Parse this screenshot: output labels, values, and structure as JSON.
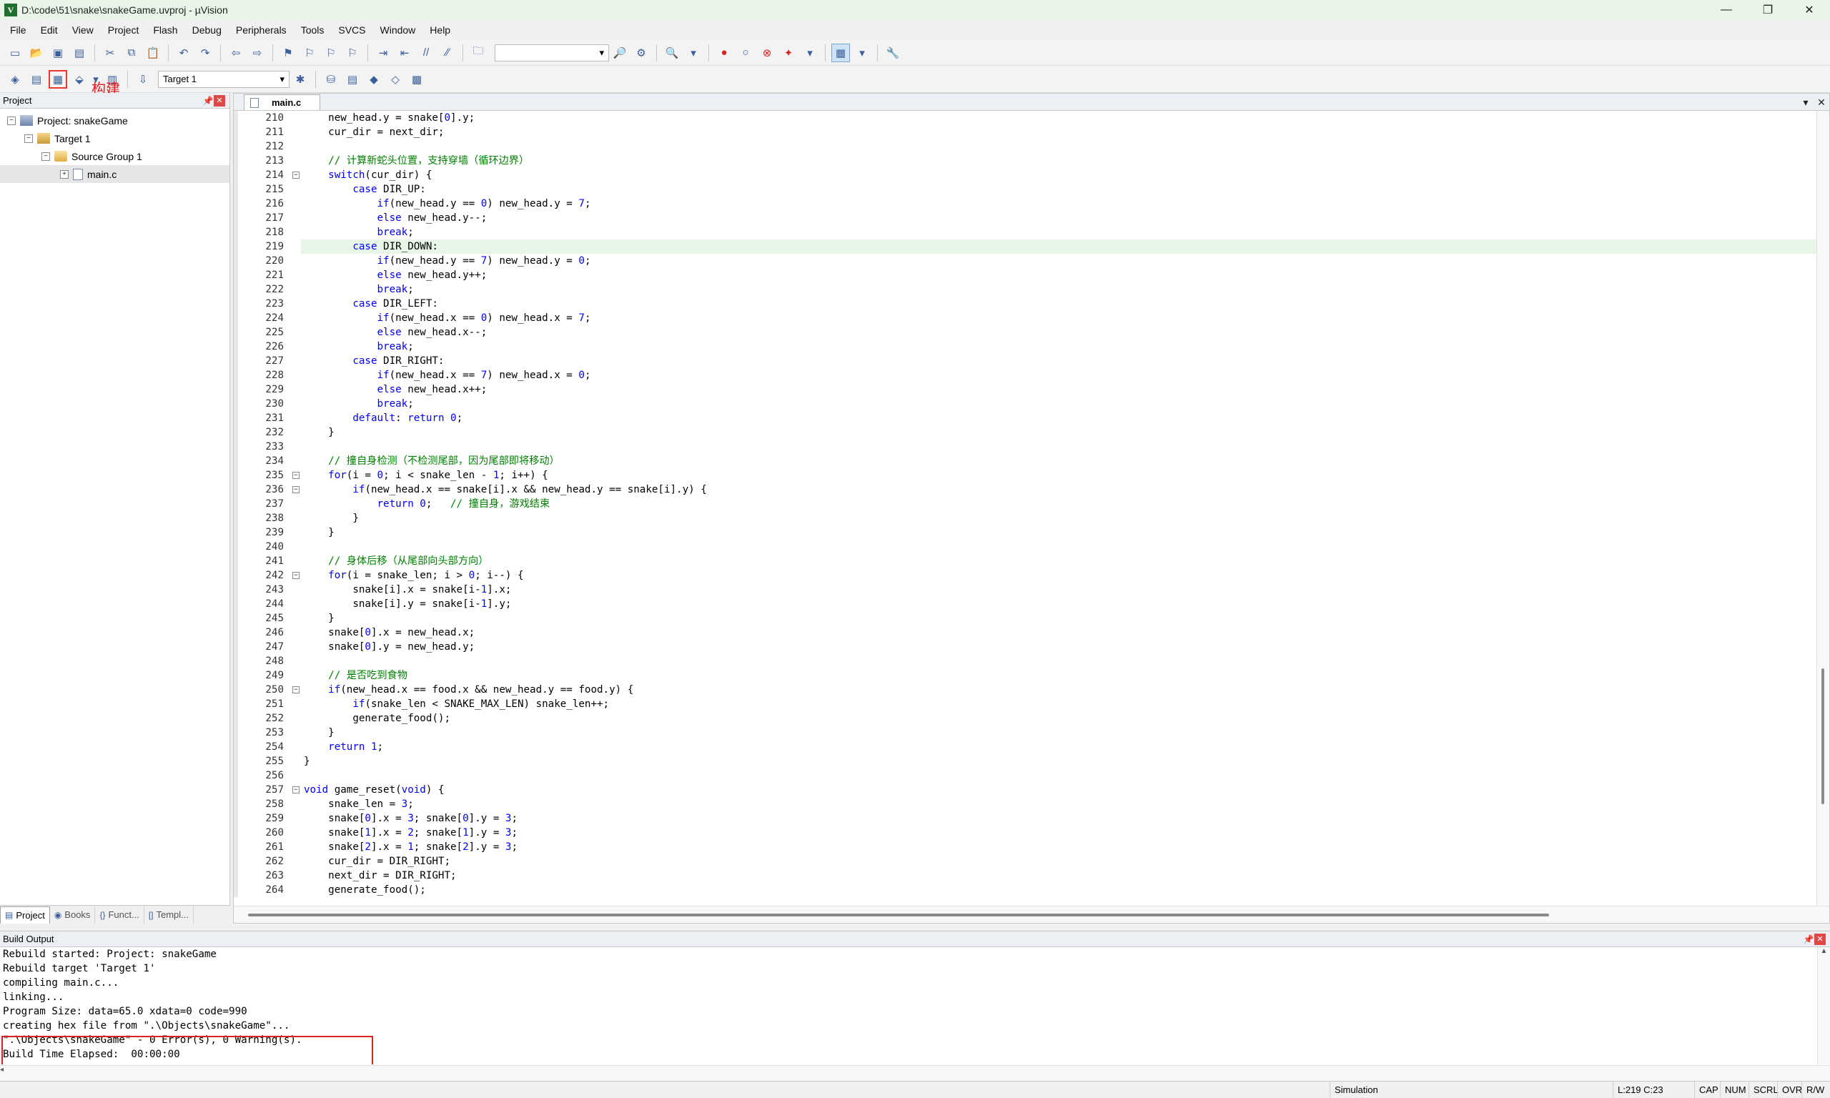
{
  "window": {
    "title": "D:\\code\\51\\snake\\snakeGame.uvproj - µVision",
    "app_icon": "V",
    "minimize": "—",
    "maximize": "❐",
    "close": "✕"
  },
  "menu": [
    "File",
    "Edit",
    "View",
    "Project",
    "Flash",
    "Debug",
    "Peripherals",
    "Tools",
    "SVCS",
    "Window",
    "Help"
  ],
  "toolbar2": {
    "target_select": "Target 1",
    "build_annotation": "构建"
  },
  "project_panel": {
    "title": "Project",
    "tree": {
      "project": "Project: snakeGame",
      "target": "Target 1",
      "group": "Source Group 1",
      "file": "main.c"
    },
    "tabs": [
      "Project",
      "Books",
      "Funct...",
      "Templ..."
    ]
  },
  "editor": {
    "tab": "main.c",
    "current_line": 219,
    "lines": [
      {
        "n": "210",
        "t": "    new_head.y = snake[0].y;"
      },
      {
        "n": "211",
        "t": "    cur_dir = next_dir;"
      },
      {
        "n": "212",
        "t": ""
      },
      {
        "n": "213",
        "t": "    // 计算新蛇头位置，支持穿墙（循环边界）"
      },
      {
        "n": "214",
        "t": "    switch(cur_dir) {"
      },
      {
        "n": "215",
        "t": "        case DIR_UP:"
      },
      {
        "n": "216",
        "t": "            if(new_head.y == 0) new_head.y = 7;"
      },
      {
        "n": "217",
        "t": "            else new_head.y--;"
      },
      {
        "n": "218",
        "t": "            break;"
      },
      {
        "n": "219",
        "t": "        case DIR_DOWN:"
      },
      {
        "n": "220",
        "t": "            if(new_head.y == 7) new_head.y = 0;"
      },
      {
        "n": "221",
        "t": "            else new_head.y++;"
      },
      {
        "n": "222",
        "t": "            break;"
      },
      {
        "n": "223",
        "t": "        case DIR_LEFT:"
      },
      {
        "n": "224",
        "t": "            if(new_head.x == 0) new_head.x = 7;"
      },
      {
        "n": "225",
        "t": "            else new_head.x--;"
      },
      {
        "n": "226",
        "t": "            break;"
      },
      {
        "n": "227",
        "t": "        case DIR_RIGHT:"
      },
      {
        "n": "228",
        "t": "            if(new_head.x == 7) new_head.x = 0;"
      },
      {
        "n": "229",
        "t": "            else new_head.x++;"
      },
      {
        "n": "230",
        "t": "            break;"
      },
      {
        "n": "231",
        "t": "        default: return 0;"
      },
      {
        "n": "232",
        "t": "    }"
      },
      {
        "n": "233",
        "t": ""
      },
      {
        "n": "234",
        "t": "    // 撞自身检测（不检测尾部，因为尾部即将移动）"
      },
      {
        "n": "235",
        "t": "    for(i = 0; i < snake_len - 1; i++) {"
      },
      {
        "n": "236",
        "t": "        if(new_head.x == snake[i].x && new_head.y == snake[i].y) {"
      },
      {
        "n": "237",
        "t": "            return 0;   // 撞自身，游戏结束"
      },
      {
        "n": "238",
        "t": "        }"
      },
      {
        "n": "239",
        "t": "    }"
      },
      {
        "n": "240",
        "t": ""
      },
      {
        "n": "241",
        "t": "    // 身体后移（从尾部向头部方向）"
      },
      {
        "n": "242",
        "t": "    for(i = snake_len; i > 0; i--) {"
      },
      {
        "n": "243",
        "t": "        snake[i].x = snake[i-1].x;"
      },
      {
        "n": "244",
        "t": "        snake[i].y = snake[i-1].y;"
      },
      {
        "n": "245",
        "t": "    }"
      },
      {
        "n": "246",
        "t": "    snake[0].x = new_head.x;"
      },
      {
        "n": "247",
        "t": "    snake[0].y = new_head.y;"
      },
      {
        "n": "248",
        "t": ""
      },
      {
        "n": "249",
        "t": "    // 是否吃到食物"
      },
      {
        "n": "250",
        "t": "    if(new_head.x == food.x && new_head.y == food.y) {"
      },
      {
        "n": "251",
        "t": "        if(snake_len < SNAKE_MAX_LEN) snake_len++;"
      },
      {
        "n": "252",
        "t": "        generate_food();"
      },
      {
        "n": "253",
        "t": "    }"
      },
      {
        "n": "254",
        "t": "    return 1;"
      },
      {
        "n": "255",
        "t": "}"
      },
      {
        "n": "256",
        "t": ""
      },
      {
        "n": "257",
        "t": "void game_reset(void) {"
      },
      {
        "n": "258",
        "t": "    snake_len = 3;"
      },
      {
        "n": "259",
        "t": "    snake[0].x = 3; snake[0].y = 3;"
      },
      {
        "n": "260",
        "t": "    snake[1].x = 2; snake[1].y = 3;"
      },
      {
        "n": "261",
        "t": "    snake[2].x = 1; snake[2].y = 3;"
      },
      {
        "n": "262",
        "t": "    cur_dir = DIR_RIGHT;"
      },
      {
        "n": "263",
        "t": "    next_dir = DIR_RIGHT;"
      },
      {
        "n": "264",
        "t": "    generate_food();"
      }
    ]
  },
  "build_output": {
    "title": "Build Output",
    "lines": [
      "Rebuild started: Project: snakeGame",
      "Rebuild target 'Target 1'",
      "compiling main.c...",
      "linking...",
      "Program Size: data=65.0 xdata=0 code=990",
      "creating hex file from \".\\Objects\\snakeGame\"...",
      "\".\\Objects\\snakeGame\" - 0 Error(s), 0 Warning(s).",
      "Build Time Elapsed:  00:00:00"
    ]
  },
  "status": {
    "mode": "Simulation",
    "position": "L:219 C:23",
    "cap": "CAP",
    "num": "NUM",
    "scrl": "SCRL",
    "ovr": "OVR",
    "rw": "R/W"
  }
}
